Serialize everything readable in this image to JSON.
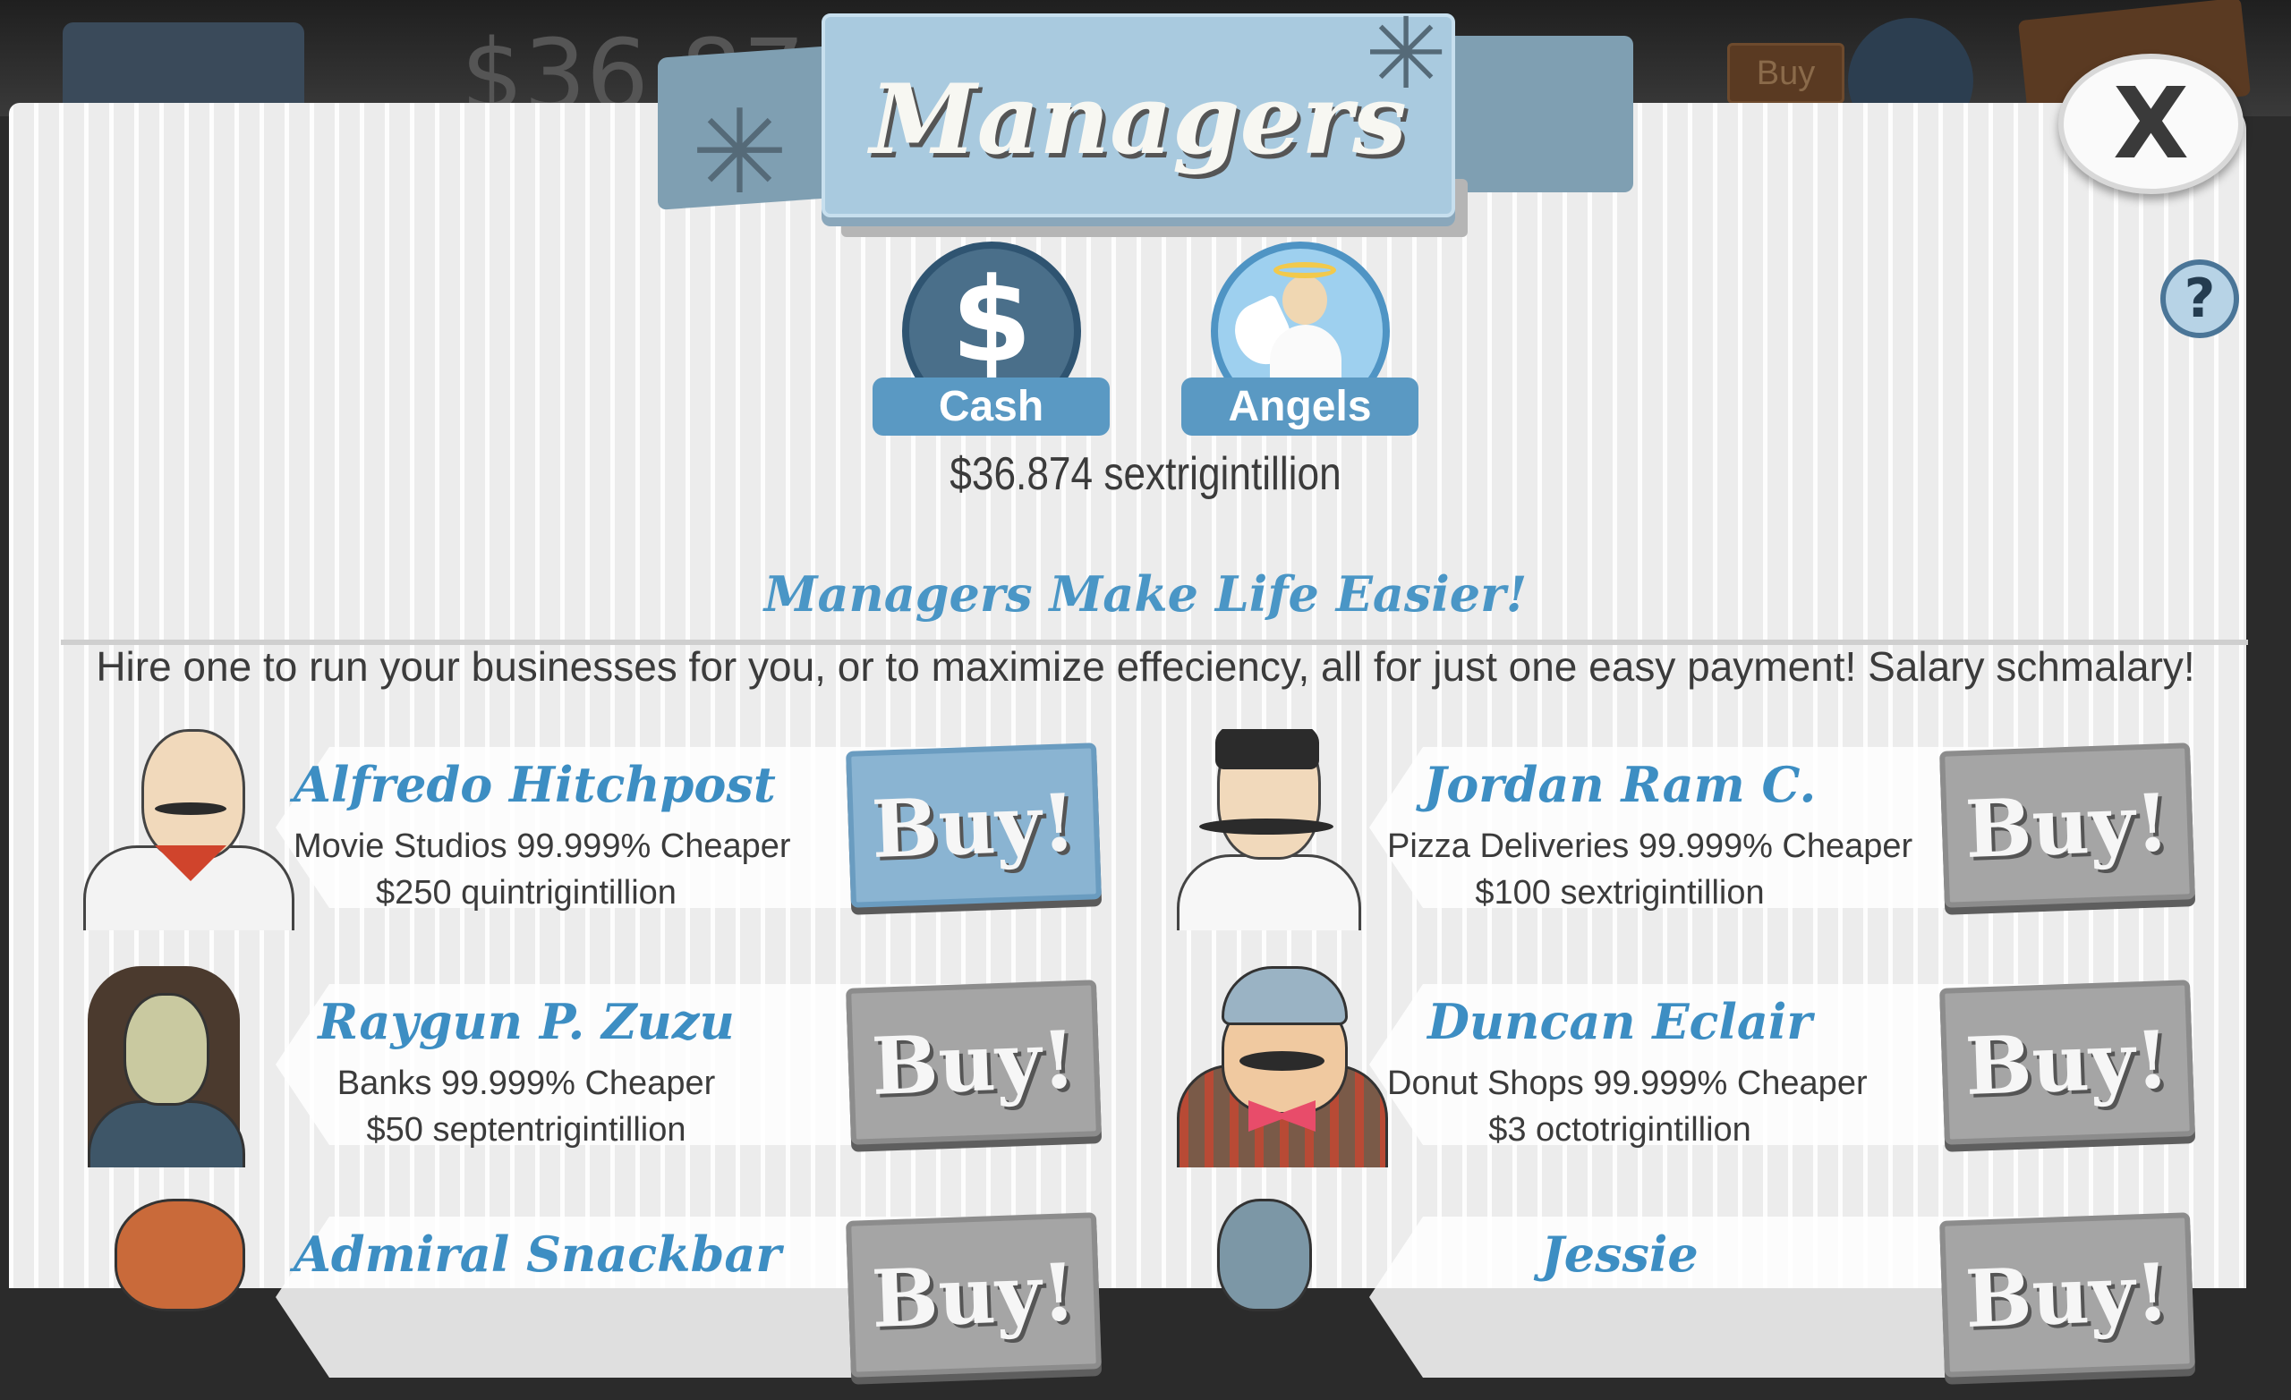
{
  "background": {
    "cash_fragment": "$36,874",
    "buy_label": "Buy"
  },
  "header": {
    "title": "Managers",
    "close_label": "X",
    "help_label": "?"
  },
  "tabs": [
    {
      "label": "Cash",
      "icon": "dollar-icon"
    },
    {
      "label": "Angels",
      "icon": "angel-icon"
    }
  ],
  "cash_amount": "$36.874 sextrigintillion",
  "subtitle": "Managers Make Life Easier!",
  "description": "Hire one to run your businesses for you, or to maximize effeciency, all for just one easy payment! Salary schmalary!",
  "managers": [
    {
      "name": "Alfredo Hitchpost",
      "effect": "Movie Studios 99.999% Cheaper",
      "cost": "$250 quintrigintillion",
      "buy_label": "Buy!",
      "enabled": true
    },
    {
      "name": "Jordan Ram C.",
      "effect": "Pizza Deliveries 99.999% Cheaper",
      "cost": "$100 sextrigintillion",
      "buy_label": "Buy!",
      "enabled": false
    },
    {
      "name": "Raygun P. Zuzu",
      "effect": "Banks 99.999% Cheaper",
      "cost": "$50 septentrigintillion",
      "buy_label": "Buy!",
      "enabled": false
    },
    {
      "name": "Duncan Eclair",
      "effect": "Donut Shops 99.999% Cheaper",
      "cost": "$3 octotrigintillion",
      "buy_label": "Buy!",
      "enabled": false
    },
    {
      "name": "Admiral Snackbar",
      "effect": "",
      "cost": "",
      "buy_label": "Buy!",
      "enabled": false
    },
    {
      "name": "Jessie",
      "effect": "",
      "cost": "",
      "buy_label": "Buy!",
      "enabled": false
    }
  ],
  "colors": {
    "accent_blue": "#4a96c6",
    "enabled_button": "#8ab4d2",
    "disabled_button": "#a5a5a5",
    "panel": "#ececec"
  }
}
